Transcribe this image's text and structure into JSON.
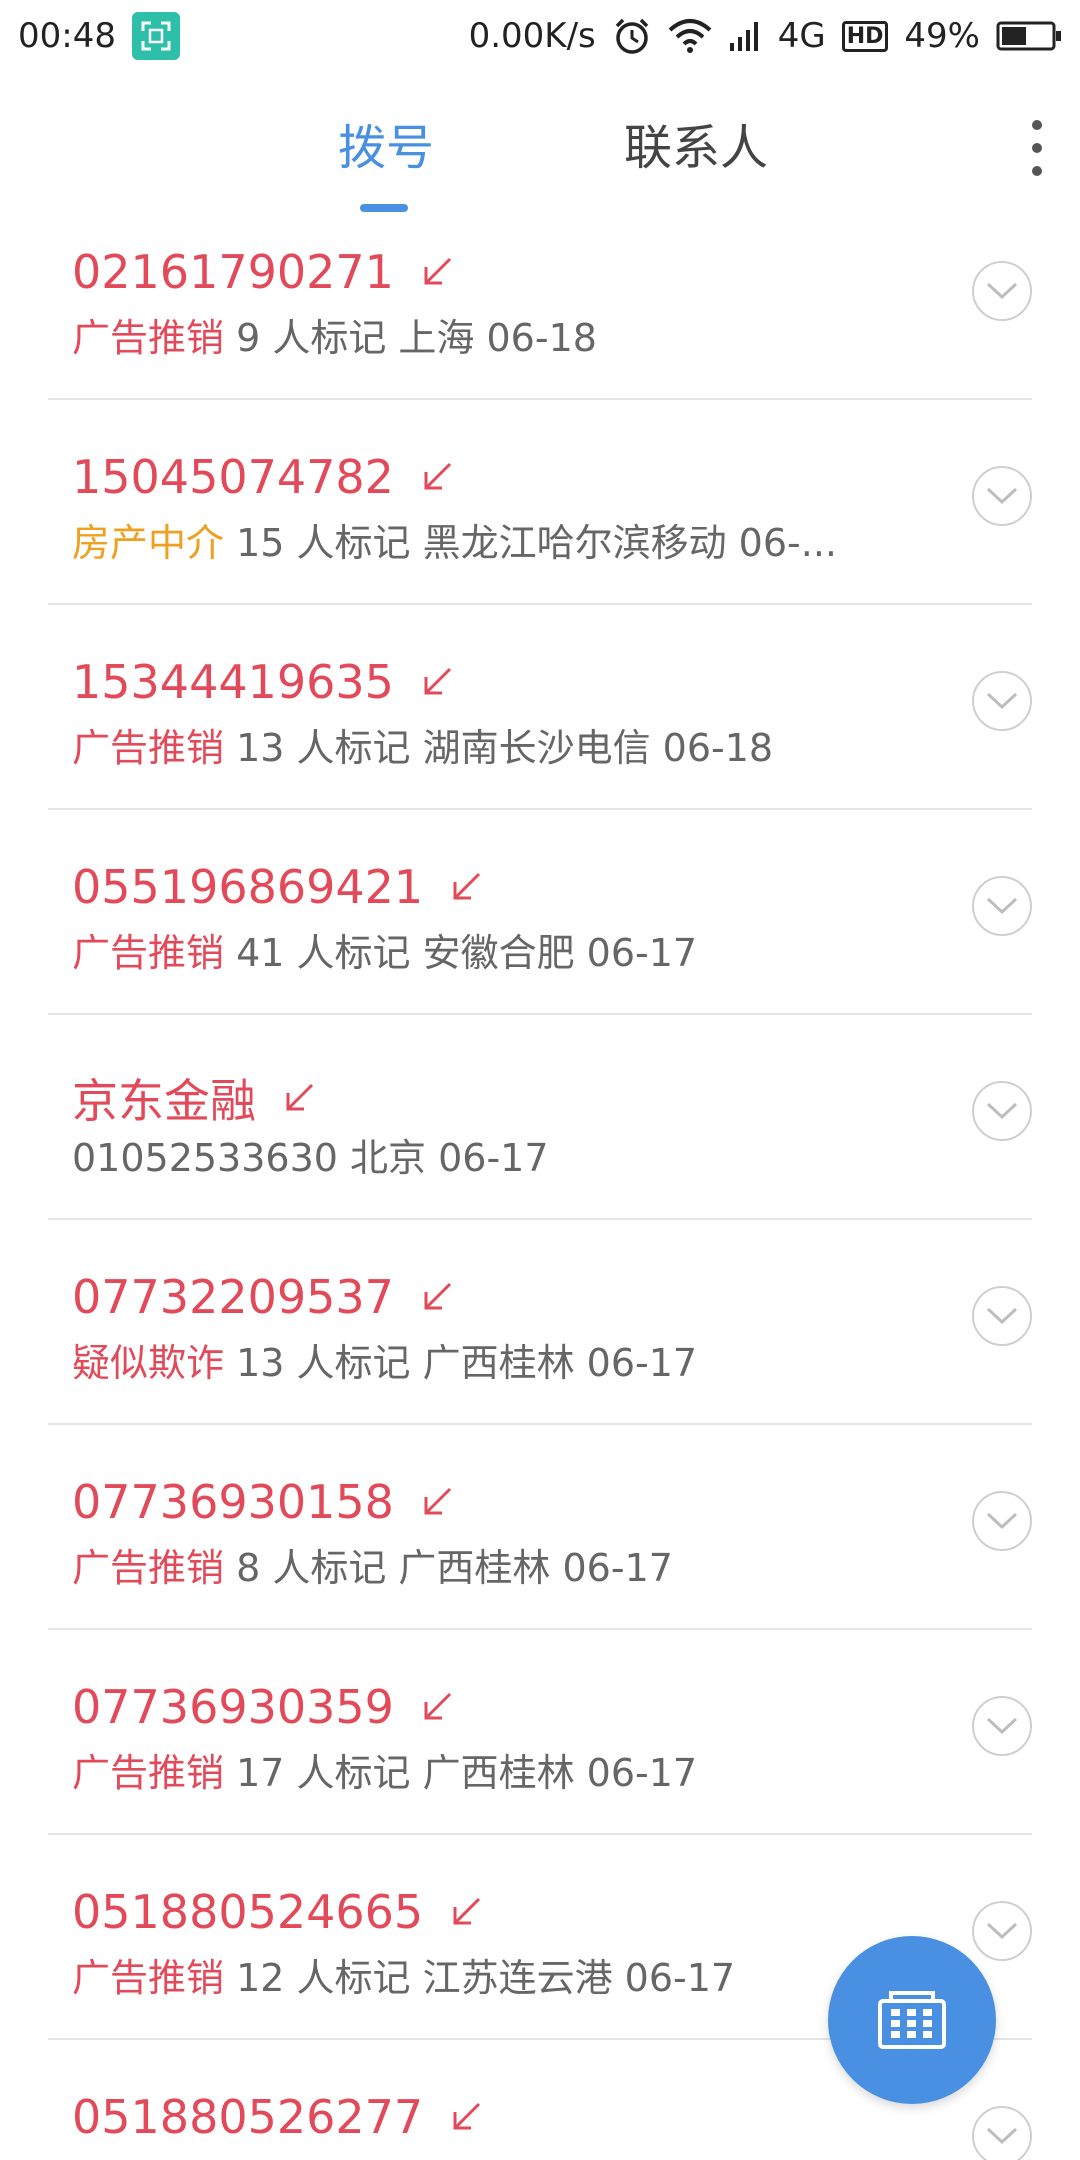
{
  "status_bar": {
    "time": "00:48",
    "network_speed": "0.00K/s",
    "network_type": "4G",
    "hd_label": "HD",
    "battery": "49%"
  },
  "tabs": [
    {
      "label": "拨号",
      "active": true
    },
    {
      "label": "联系人",
      "active": false
    }
  ],
  "calls": [
    {
      "number": "02161790271",
      "tag": "广告推销",
      "tag_color": "red",
      "info": " 9 人标记 上海 06-18"
    },
    {
      "number": "15045074782",
      "tag": "房产中介",
      "tag_color": "orange",
      "info": " 15 人标记 黑龙江哈尔滨移动 06-..."
    },
    {
      "number": "15344419635",
      "tag": "广告推销",
      "tag_color": "red",
      "info": " 13 人标记 湖南长沙电信 06-18"
    },
    {
      "number": "055196869421",
      "tag": "广告推销",
      "tag_color": "red",
      "info": " 41 人标记 安徽合肥 06-17"
    },
    {
      "number": "京东金融",
      "tag": "",
      "tag_color": "",
      "info": "01052533630 北京 06-17"
    },
    {
      "number": "07732209537",
      "tag": "疑似欺诈",
      "tag_color": "red",
      "info": " 13 人标记 广西桂林 06-17"
    },
    {
      "number": "07736930158",
      "tag": "广告推销",
      "tag_color": "red",
      "info": " 8 人标记 广西桂林 06-17"
    },
    {
      "number": "07736930359",
      "tag": "广告推销",
      "tag_color": "red",
      "info": " 17 人标记 广西桂林 06-17"
    },
    {
      "number": "051880524665",
      "tag": "广告推销",
      "tag_color": "red",
      "info": " 12 人标记 江苏连云港 06-17"
    },
    {
      "number": "051880526277",
      "tag": "",
      "tag_color": "",
      "info": ""
    }
  ],
  "colors": {
    "accent": "#4a90e2",
    "missed_call": "#e24a5a",
    "tag_orange": "#f0a020"
  },
  "icons": {
    "missed_call": "missed-call-arrow-icon",
    "detail": "chevron-down-circle-icon",
    "dialpad": "dialpad-icon"
  }
}
